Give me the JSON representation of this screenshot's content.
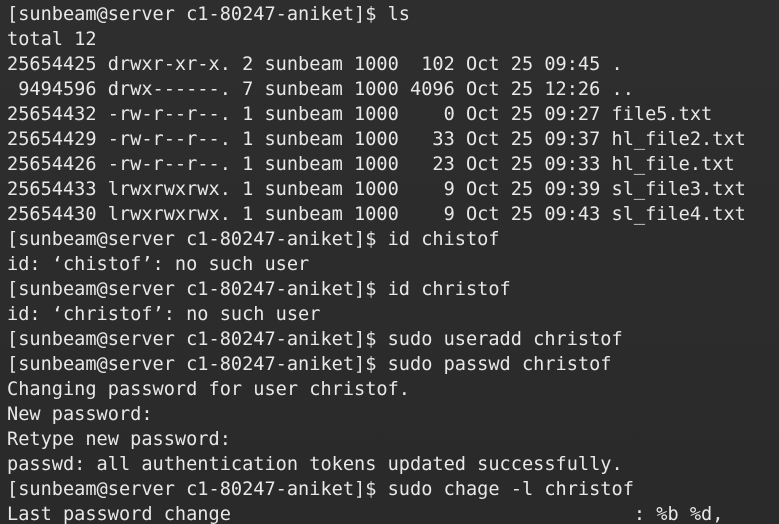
{
  "terminal": {
    "lines": [
      "[sunbeam@server c1-80247-aniket]$ ls",
      "total 12",
      "25654425 drwxr-xr-x. 2 sunbeam 1000  102 Oct 25 09:45 .",
      " 9494596 drwx------. 7 sunbeam 1000 4096 Oct 25 12:26 ..",
      "25654432 -rw-r--r--. 1 sunbeam 1000    0 Oct 25 09:27 file5.txt",
      "25654429 -rw-r--r--. 1 sunbeam 1000   33 Oct 25 09:37 hl_file2.txt",
      "25654426 -rw-r--r--. 1 sunbeam 1000   23 Oct 25 09:33 hl_file.txt",
      "25654433 lrwxrwxrwx. 1 sunbeam 1000    9 Oct 25 09:39 sl_file3.txt",
      "25654430 lrwxrwxrwx. 1 sunbeam 1000    9 Oct 25 09:43 sl_file4.txt",
      "[sunbeam@server c1-80247-aniket]$ id chistof",
      "id: ‘chistof’: no such user",
      "[sunbeam@server c1-80247-aniket]$ id christof",
      "id: ‘christof’: no such user",
      "[sunbeam@server c1-80247-aniket]$ sudo useradd christof",
      "[sunbeam@server c1-80247-aniket]$ sudo passwd christof",
      "Changing password for user christof.",
      "New password:",
      "Retype new password:",
      "passwd: all authentication tokens updated successfully.",
      "[sunbeam@server c1-80247-aniket]$ sudo chage -l christof",
      "Last password change                                    : %b %d,"
    ]
  },
  "colors": {
    "background": "#2b2b2b",
    "foreground": "#e8e8e8"
  }
}
